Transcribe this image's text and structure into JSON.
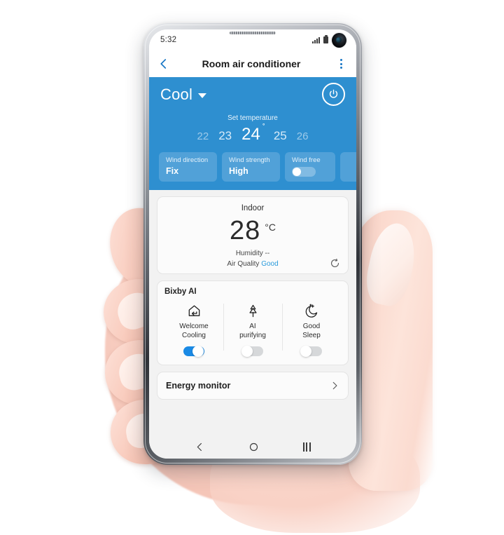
{
  "status_bar": {
    "time": "5:32",
    "icons": [
      "signal-icon",
      "battery-icon",
      "front-camera-punch-hole"
    ]
  },
  "app_bar": {
    "back_icon": "back-chevron-icon",
    "title": "Room air conditioner",
    "menu_icon": "more-options-icon"
  },
  "control_panel": {
    "mode": "Cool",
    "mode_caret": "chevron-down-icon",
    "power_icon": "power-icon",
    "set_temperature_label": "Set temperature",
    "temperatures": [
      "22",
      "23",
      "24",
      "25",
      "26"
    ],
    "selected_temperature": "24",
    "degree_symbol": "˚",
    "accent_color": "#2e8fd0",
    "tiles": [
      {
        "label": "Wind direction",
        "value": "Fix",
        "type": "value"
      },
      {
        "label": "Wind strength",
        "value": "High",
        "type": "value"
      },
      {
        "label": "Wind free",
        "value": "",
        "type": "switch",
        "switch_on": false
      }
    ]
  },
  "indoor_card": {
    "title": "Indoor",
    "temperature": "28",
    "unit": "°C",
    "humidity": "Humidity --",
    "air_quality_label": "Air Quality",
    "air_quality_value": "Good",
    "air_quality_color": "#2a9bdc",
    "refresh_icon": "refresh-icon"
  },
  "bixby_card": {
    "title": "Bixby AI",
    "items": [
      {
        "icon": "welcome-cooling-home-icon",
        "label": "Welcome\nCooling",
        "label_line1": "Welcome",
        "label_line2": "Cooling",
        "switch_on": true
      },
      {
        "icon": "ai-purifying-tree-icon",
        "label": "AI\npurifying",
        "label_line1": "AI",
        "label_line2": "purifying",
        "switch_on": false
      },
      {
        "icon": "good-sleep-moon-icon",
        "label": "Good\nSleep",
        "label_line1": "Good",
        "label_line2": "Sleep",
        "switch_on": false
      }
    ],
    "switch_on_color": "#1a8ae5",
    "switch_off_color": "#d6d8da"
  },
  "energy_card": {
    "label": "Energy monitor",
    "chevron_icon": "chevron-right-icon"
  },
  "nav_bar": {
    "back_icon": "nav-back-icon",
    "home_icon": "nav-home-icon",
    "recents_icon": "nav-recents-icon"
  }
}
